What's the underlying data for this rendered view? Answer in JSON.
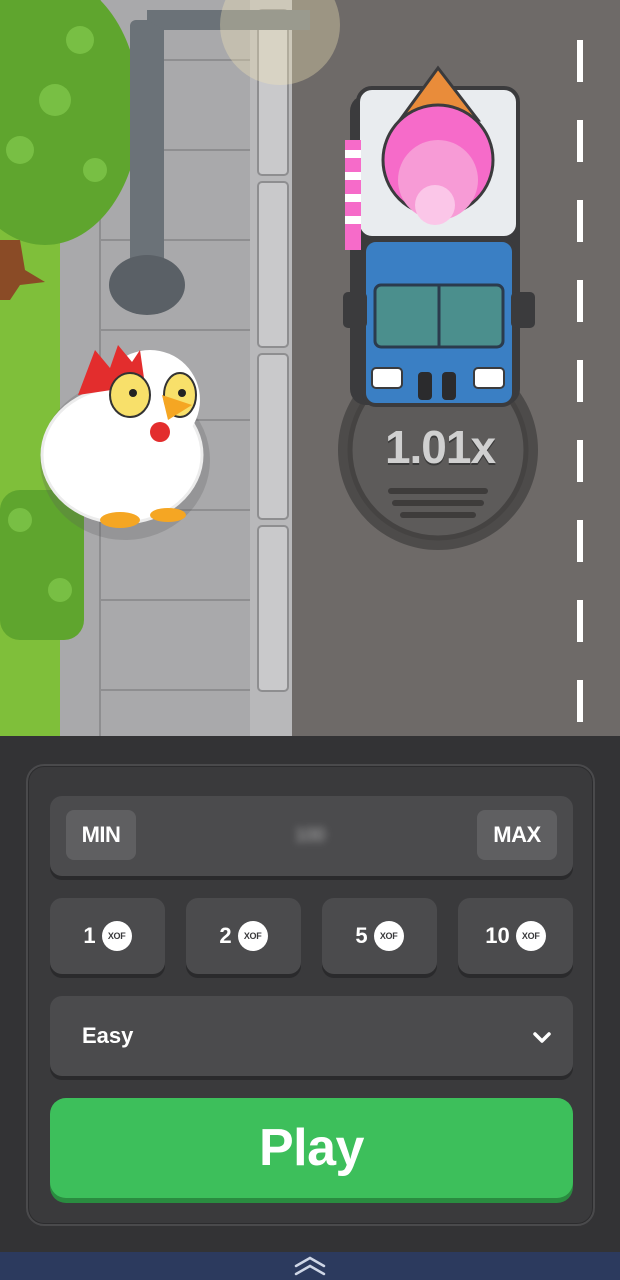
{
  "game": {
    "multiplier": "1.01x"
  },
  "controls": {
    "min_label": "MIN",
    "max_label": "MAX",
    "bet_value": "100",
    "quick_bets": [
      {
        "amount": "1",
        "currency": "XOF"
      },
      {
        "amount": "2",
        "currency": "XOF"
      },
      {
        "amount": "5",
        "currency": "XOF"
      },
      {
        "amount": "10",
        "currency": "XOF"
      }
    ],
    "difficulty": "Easy",
    "play_label": "Play"
  },
  "colors": {
    "play": "#3dbf5b",
    "panel": "#3a3a3c",
    "road": "#6e6a68"
  },
  "icons": {
    "difficulty_dropdown": "chevron-down-icon",
    "bottom_bar": "double-chevron-up-icon"
  }
}
